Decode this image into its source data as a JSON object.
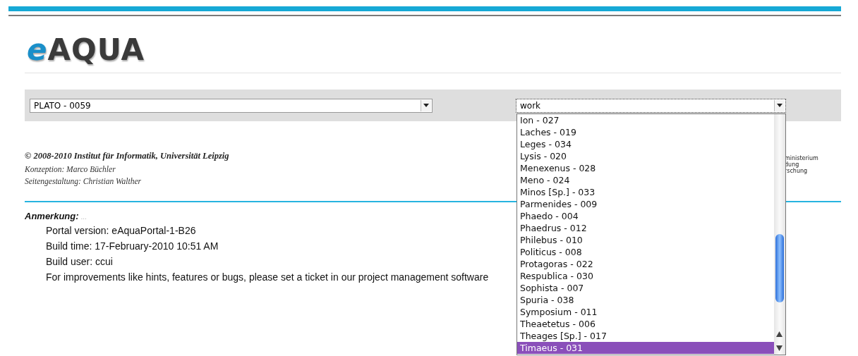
{
  "logo": {
    "text": "AQUA",
    "prefix": "e"
  },
  "selectors": {
    "author": {
      "value": "PLATO - 0059"
    },
    "work": {
      "value": "work",
      "expanded": true,
      "options": [
        {
          "label": "Ion - 027",
          "selected": false
        },
        {
          "label": "Laches - 019",
          "selected": false
        },
        {
          "label": "Leges - 034",
          "selected": false
        },
        {
          "label": "Lysis - 020",
          "selected": false
        },
        {
          "label": "Menexenus - 028",
          "selected": false
        },
        {
          "label": "Meno - 024",
          "selected": false
        },
        {
          "label": "Minos [Sp.] - 033",
          "selected": false
        },
        {
          "label": "Parmenides - 009",
          "selected": false
        },
        {
          "label": "Phaedo - 004",
          "selected": false
        },
        {
          "label": "Phaedrus - 012",
          "selected": false
        },
        {
          "label": "Philebus - 010",
          "selected": false
        },
        {
          "label": "Politicus - 008",
          "selected": false
        },
        {
          "label": "Protagoras - 022",
          "selected": false
        },
        {
          "label": "Respublica - 030",
          "selected": false
        },
        {
          "label": "Sophista - 007",
          "selected": false
        },
        {
          "label": "Spuria - 038",
          "selected": false
        },
        {
          "label": "Symposium - 011",
          "selected": false
        },
        {
          "label": "Theaetetus - 006",
          "selected": false
        },
        {
          "label": "Theages [Sp.] - 017",
          "selected": false
        },
        {
          "label": "Timaeus - 031",
          "selected": true
        }
      ]
    }
  },
  "footer": {
    "copyright": "© 2008-2010 Institut für Informatik, Universität Leipzig",
    "credits": [
      "Konzeption: Marco Büchler",
      "Seitengestaltung: Christian Walther"
    ],
    "sponsor_lines": [
      "ministerium",
      "dung",
      "rschung"
    ]
  },
  "note": {
    "heading": "Anmerkung:",
    "ellipsis": "...",
    "lines": [
      "Portal version: eAquaPortal-1-B26",
      "Build time: 17-February-2010 10:51 AM",
      "Build user: ccui",
      "For improvements like hints, features or bugs, please set a ticket in our project management software"
    ]
  }
}
